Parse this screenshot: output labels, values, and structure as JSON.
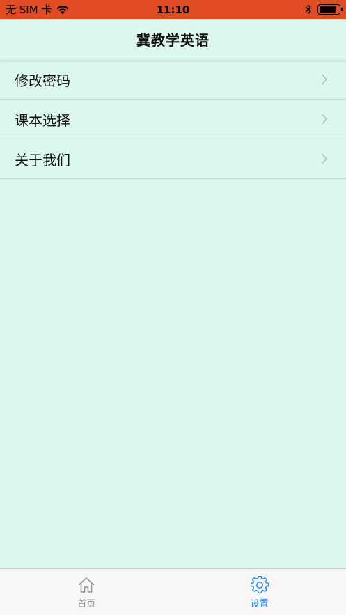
{
  "status_bar": {
    "carrier": "无 SIM 卡",
    "time": "11:10",
    "wifi_icon": "wifi-icon",
    "bluetooth_icon": "bluetooth-icon",
    "battery_icon": "battery-icon",
    "battery_level": 0.85
  },
  "nav": {
    "title": "冀教学英语"
  },
  "menu": {
    "items": [
      {
        "label": "修改密码",
        "icon": "chevron-right-icon"
      },
      {
        "label": "课本选择",
        "icon": "chevron-right-icon"
      },
      {
        "label": "关于我们",
        "icon": "chevron-right-icon"
      }
    ]
  },
  "tabs": {
    "home": {
      "label": "首页",
      "icon": "home-icon"
    },
    "settings": {
      "label": "设置",
      "icon": "gear-icon",
      "selected": true
    }
  },
  "colors": {
    "status_bar_bg": "#e24c24",
    "background": "#dcf7ee",
    "accent": "#1a82f5",
    "inactive_tab": "#8e8e93"
  }
}
